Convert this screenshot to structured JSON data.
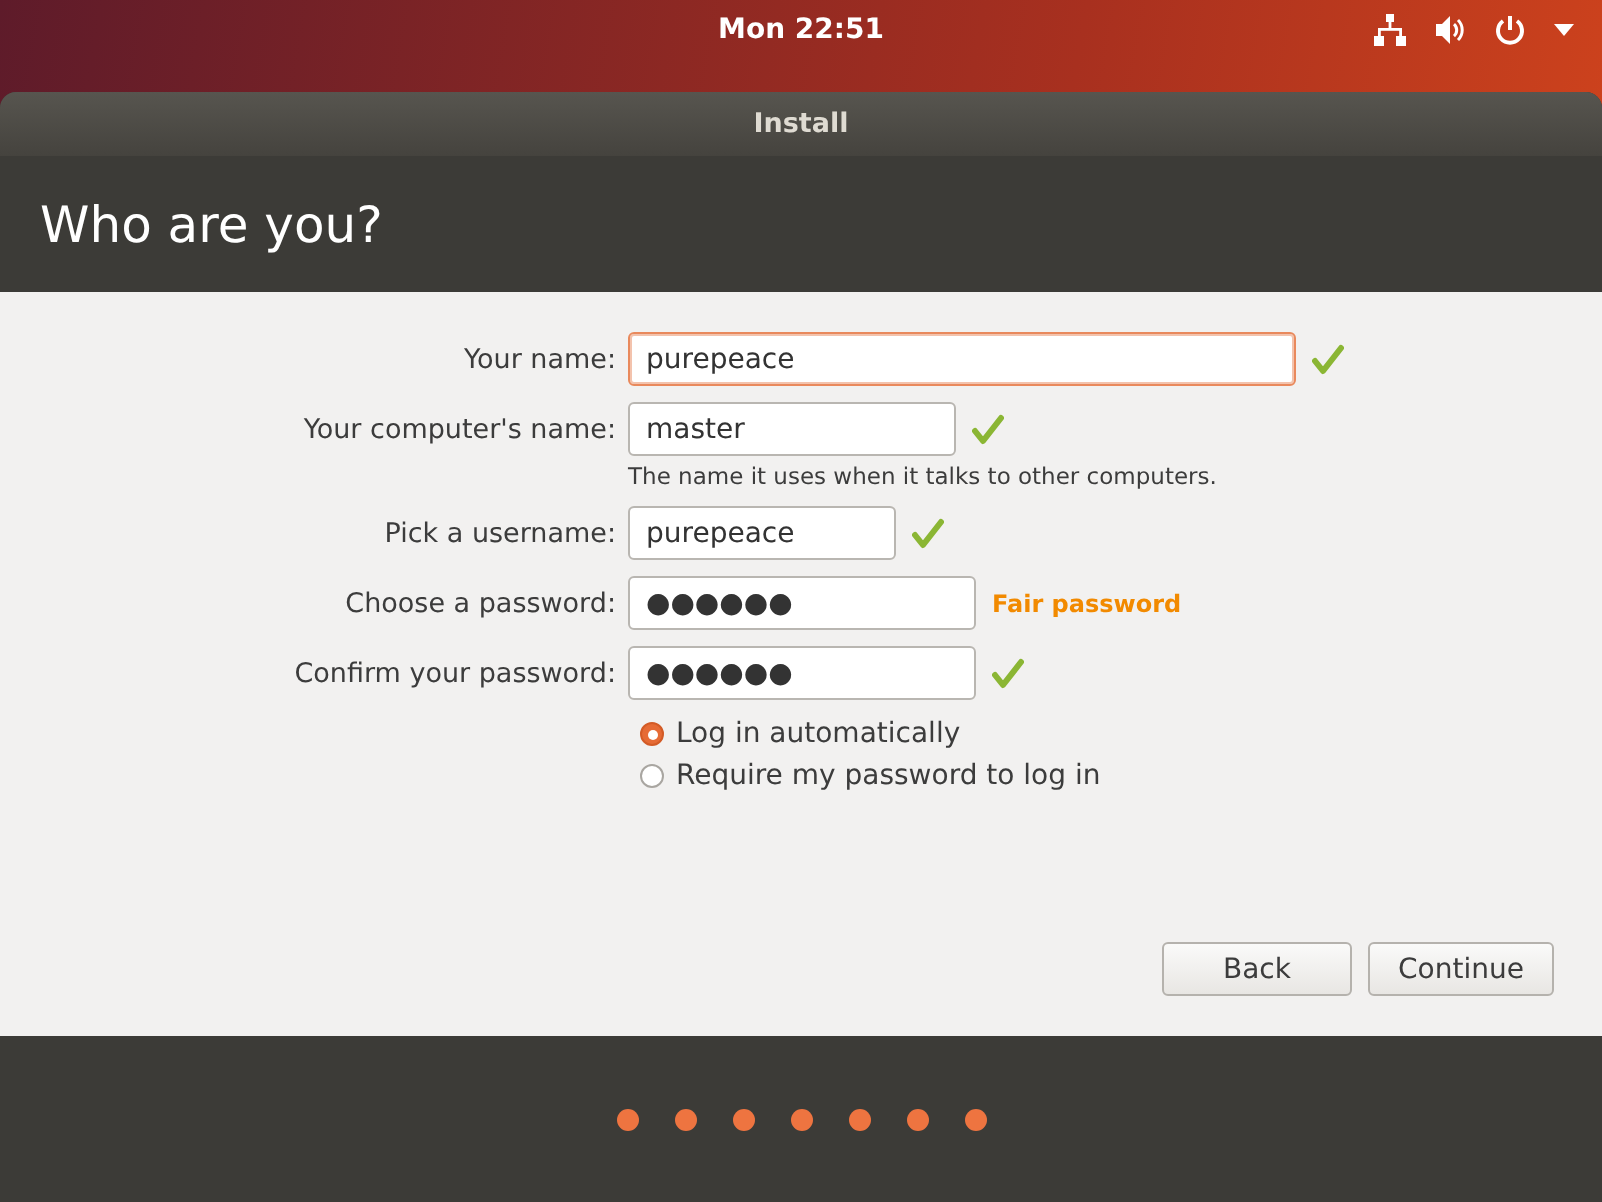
{
  "top_bar": {
    "clock": "Mon 22:51"
  },
  "window": {
    "title": "Install"
  },
  "header": {
    "heading": "Who are you?"
  },
  "form": {
    "fields": [
      {
        "label": "Your name:",
        "value": "purepeace",
        "focused": true,
        "valid": true
      },
      {
        "label": "Your computer's name:",
        "value": "master",
        "focused": false,
        "valid": true,
        "hint": "The name it uses when it talks to other computers."
      },
      {
        "label": "Pick a username:",
        "value": "purepeace",
        "focused": false,
        "valid": true
      },
      {
        "label": "Choose a password:",
        "value": "●●●●●●",
        "focused": false,
        "valid": false,
        "strength": "Fair password"
      },
      {
        "label": "Confirm your password:",
        "value": "●●●●●●",
        "focused": false,
        "valid": true
      }
    ],
    "login_options": [
      {
        "label": "Log in automatically",
        "selected": true
      },
      {
        "label": "Require my password to log in",
        "selected": false
      }
    ]
  },
  "buttons": [
    {
      "label": "Back"
    },
    {
      "label": "Continue"
    }
  ]
}
